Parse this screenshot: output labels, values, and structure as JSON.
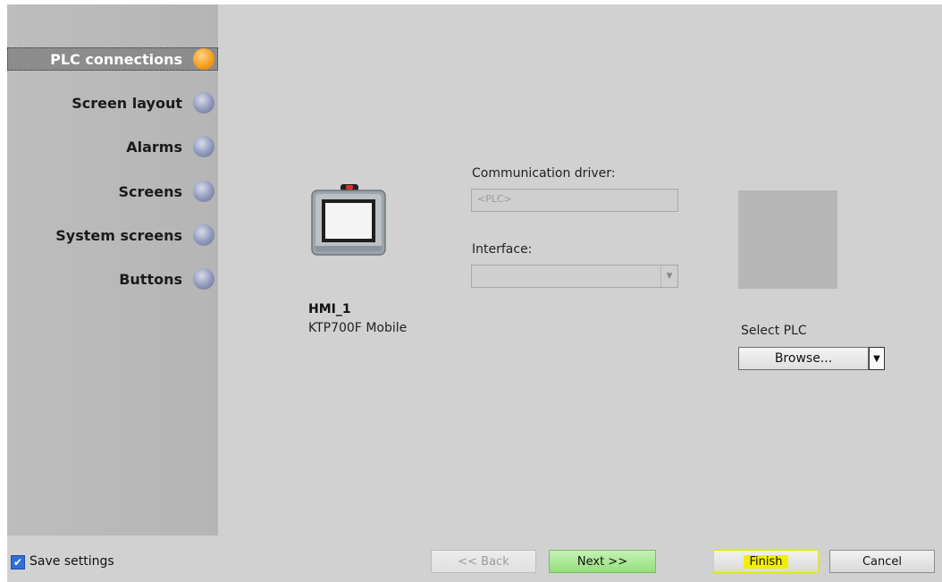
{
  "sidebar": {
    "items": [
      {
        "label": "PLC connections",
        "active": true
      },
      {
        "label": "Screen layout",
        "active": false
      },
      {
        "label": "Alarms",
        "active": false
      },
      {
        "label": "Screens",
        "active": false
      },
      {
        "label": "System screens",
        "active": false
      },
      {
        "label": "Buttons",
        "active": false
      }
    ]
  },
  "device": {
    "name": "HMI_1",
    "model": "KTP700F Mobile",
    "icon": "hmi-panel-icon"
  },
  "form": {
    "communication_driver_label": "Communication driver:",
    "communication_driver_value": "<PLC>",
    "interface_label": "Interface:",
    "interface_value": ""
  },
  "select_plc": {
    "label": "Select PLC",
    "browse_label": "Browse..."
  },
  "footer": {
    "save_settings_label": "Save settings",
    "save_settings_checked": true,
    "back_label": "<< Back",
    "next_label": "Next >>",
    "finish_label": "Finish",
    "cancel_label": "Cancel"
  },
  "colors": {
    "active_dot": "#f5a01e",
    "inactive_dot": "#8e97b8",
    "next_button": "#95df7c",
    "finish_highlight": "#f0ef00"
  }
}
